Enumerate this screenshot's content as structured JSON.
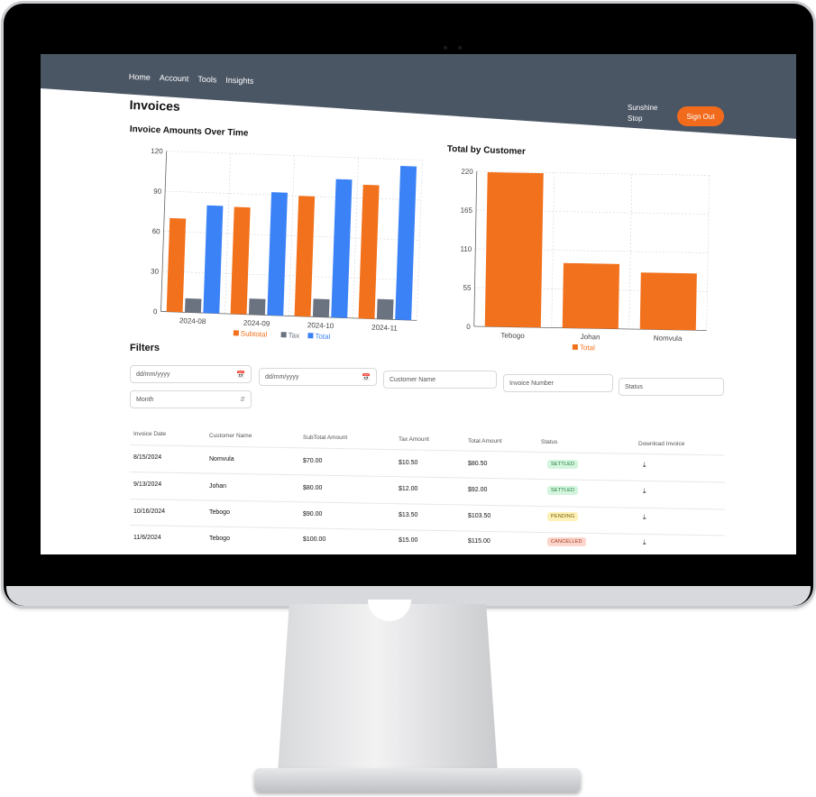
{
  "nav": {
    "items": [
      "Home",
      "Account",
      "Tools",
      "Insights"
    ]
  },
  "header": {
    "title": "Invoices",
    "user_name": "Sunshine Stop",
    "signout_label": "Sign Out"
  },
  "colors": {
    "subtotal": "#f2711c",
    "tax": "#6b7280",
    "total": "#3b82f6",
    "nav_bg": "#4b5665"
  },
  "chart_data": [
    {
      "type": "bar",
      "title": "Invoice Amounts Over Time",
      "categories": [
        "2024-08",
        "2024-09",
        "2024-10",
        "2024-11"
      ],
      "series": [
        {
          "name": "Subtotal",
          "values": [
            70,
            80,
            90,
            100
          ]
        },
        {
          "name": "Tax",
          "values": [
            10.5,
            12,
            13.5,
            15
          ]
        },
        {
          "name": "Total",
          "values": [
            80.5,
            92,
            103.5,
            115
          ]
        }
      ],
      "yticks": [
        "0",
        "30",
        "60",
        "90",
        "120"
      ],
      "ylim": [
        0,
        120
      ],
      "grid": true,
      "legend": "bottom"
    },
    {
      "type": "bar",
      "title": "Total by Customer",
      "categories": [
        "Tebogo",
        "Johan",
        "Nomvula"
      ],
      "series": [
        {
          "name": "Total",
          "values": [
            219,
            92,
            80.5
          ]
        }
      ],
      "yticks": [
        "0",
        "55",
        "110",
        "165",
        "220"
      ],
      "ylim": [
        0,
        220
      ],
      "grid": true,
      "legend": "bottom"
    }
  ],
  "filters": {
    "title": "Filters",
    "date_from_placeholder": "dd/mm/yyyy",
    "date_to_placeholder": "dd/mm/yyyy",
    "customer_placeholder": "Customer Name",
    "invoice_placeholder": "Invoice Number",
    "status_placeholder": "Status",
    "period_value": "Month"
  },
  "table": {
    "columns": [
      "Invoice Date",
      "Customer Name",
      "SubTotal Amount",
      "Tax Amount",
      "Total Amount",
      "Status",
      "Download Invoice"
    ],
    "rows": [
      {
        "date": "8/15/2024",
        "customer": "Nomvula",
        "subtotal": "$70.00",
        "tax": "$10.50",
        "total": "$80.50",
        "status": "SETTLED",
        "status_kind": "settled"
      },
      {
        "date": "9/13/2024",
        "customer": "Johan",
        "subtotal": "$80.00",
        "tax": "$12.00",
        "total": "$92.00",
        "status": "SETTLED",
        "status_kind": "settled"
      },
      {
        "date": "10/16/2024",
        "customer": "Tebogo",
        "subtotal": "$90.00",
        "tax": "$13.50",
        "total": "$103.50",
        "status": "PENDING",
        "status_kind": "pending"
      },
      {
        "date": "11/6/2024",
        "customer": "Tebogo",
        "subtotal": "$100.00",
        "tax": "$15.00",
        "total": "$115.00",
        "status": "CANCELLED",
        "status_kind": "cancelled"
      }
    ]
  }
}
